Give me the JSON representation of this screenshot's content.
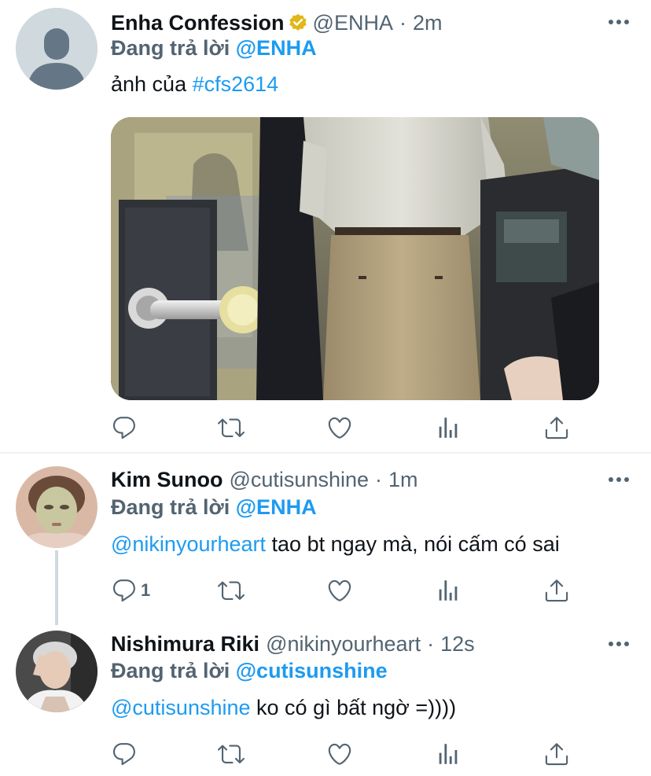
{
  "tweets": [
    {
      "display_name": "Enha Confession",
      "verified": true,
      "handle": "@ENHA",
      "separator": "·",
      "time": "2m",
      "reply_label": "Đang trả lời",
      "reply_to": "@ENHA",
      "text_prefix": "ảnh của",
      "hashtag": "#cfs2614",
      "has_media": true,
      "reply_count": ""
    },
    {
      "display_name": "Kim Sunoo",
      "verified": false,
      "handle": "@cutisunshine",
      "separator": "·",
      "time": "1m",
      "reply_label": "Đang trả lời",
      "reply_to": "@ENHA",
      "mention": "@nikinyourheart",
      "text": "tao bt ngay mà, nói cấm có sai",
      "reply_count": "1"
    },
    {
      "display_name": "Nishimura Riki",
      "verified": false,
      "handle": "@nikinyourheart",
      "separator": "·",
      "time": "12s",
      "reply_label": "Đang trả lời",
      "reply_to": "@cutisunshine",
      "mention": "@cutisunshine",
      "text": "ko có gì bất ngờ =))))",
      "reply_count": ""
    }
  ],
  "icons": {
    "reply": "reply-icon",
    "retweet": "retweet-icon",
    "like": "heart-icon",
    "analytics": "analytics-icon",
    "share": "share-icon",
    "more": "more-icon",
    "verified": "verified-badge-icon"
  },
  "colors": {
    "link": "#1d9bf0",
    "secondary": "#536471",
    "verified_gold": "#e2b719",
    "thread_line": "#cfd9de"
  }
}
